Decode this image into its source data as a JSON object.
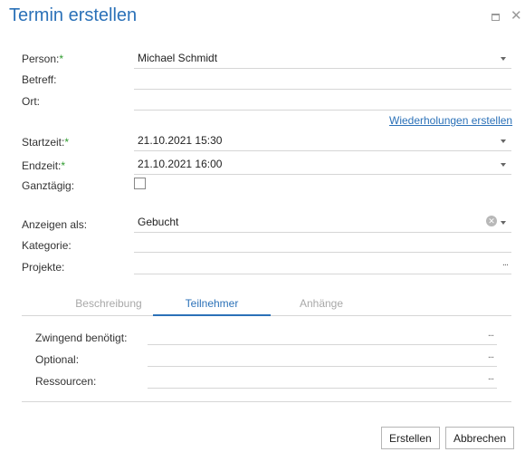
{
  "dialog": {
    "title": "Termin erstellen"
  },
  "form": {
    "person": {
      "label": "Person:",
      "required": "*",
      "value": "Michael Schmidt"
    },
    "betreff": {
      "label": "Betreff:",
      "value": ""
    },
    "ort": {
      "label": "Ort:",
      "value": ""
    },
    "repeat_link": "Wiederholungen erstellen",
    "start": {
      "label": "Startzeit:",
      "required": "*",
      "value": "21.10.2021 15:30"
    },
    "end": {
      "label": "Endzeit:",
      "required": "*",
      "value": "21.10.2021 16:00"
    },
    "allday": {
      "label": "Ganztägig:",
      "checked": false
    },
    "show_as": {
      "label": "Anzeigen als:",
      "value": "Gebucht"
    },
    "category": {
      "label": "Kategorie:",
      "value": ""
    },
    "projects": {
      "label": "Projekte:",
      "value": ""
    },
    "ellipsis": "..."
  },
  "tabs": [
    {
      "label": "Beschreibung",
      "active": false
    },
    {
      "label": "Teilnehmer",
      "active": true
    },
    {
      "label": "Anhänge",
      "active": false
    }
  ],
  "participants": {
    "required": {
      "label": "Zwingend benötigt:"
    },
    "optional": {
      "label": "Optional:"
    },
    "resources": {
      "label": "Ressourcen:"
    }
  },
  "buttons": {
    "create": "Erstellen",
    "cancel": "Abbrechen"
  },
  "colors": {
    "accent": "#2b71b8",
    "required": "#2e9b2e"
  }
}
